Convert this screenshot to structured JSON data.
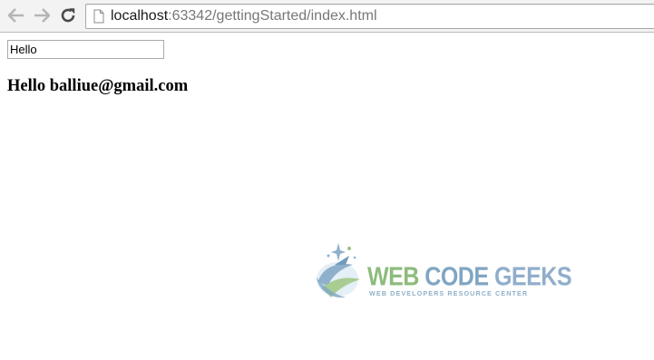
{
  "browser": {
    "url_host": "localhost",
    "url_rest": ":63342/gettingStarted/index.html",
    "icons": {
      "back": "back-arrow-icon",
      "forward": "forward-arrow-icon",
      "reload": "reload-icon",
      "page": "page-icon"
    }
  },
  "page": {
    "input_value": "Hello",
    "greeting": "Hello balliue@gmail.com"
  },
  "watermark": {
    "title_web": "WEB ",
    "title_code": "CODE ",
    "title_geeks": "GEEKS",
    "subtitle": "WEB DEVELOPERS RESOURCE CENTER",
    "colors": {
      "green": "#8dbb7c",
      "blue": "#7fa6c3"
    }
  }
}
